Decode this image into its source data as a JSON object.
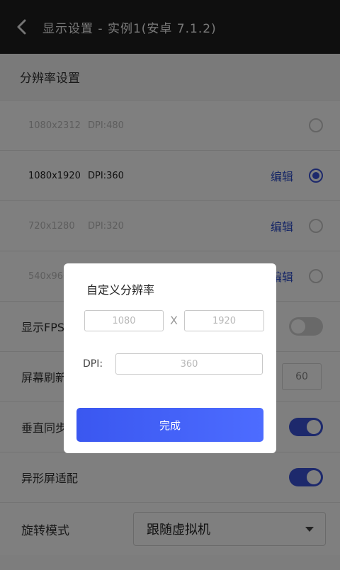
{
  "header": {
    "back_icon": "chevron-left-icon",
    "title": "显示设置 - 实例1(安卓 7.1.2)"
  },
  "resolution_section": {
    "title": "分辨率设置",
    "items": [
      {
        "res": "1080x2312",
        "dpi": "DPI:480",
        "edit": "",
        "selected": false,
        "enabled": false
      },
      {
        "res": "1080x1920",
        "dpi": "DPI:360",
        "edit": "编辑",
        "selected": true,
        "enabled": true
      },
      {
        "res": "720x1280",
        "dpi": "DPI:320",
        "edit": "编辑",
        "selected": false,
        "enabled": false
      },
      {
        "res": "540x960",
        "dpi": "",
        "edit": "编辑",
        "selected": false,
        "enabled": false
      }
    ]
  },
  "settings": {
    "show_fps_label": "显示FPS",
    "show_fps_on": false,
    "refresh_label": "屏幕刷新",
    "refresh_value": "60",
    "vsync_label": "垂直同步",
    "vsync_on": true,
    "notch_label": "异形屏适配",
    "notch_on": true,
    "rotate_label": "旋转模式",
    "rotate_value": "跟随虚拟机"
  },
  "dialog": {
    "title": "自定义分辨率",
    "width_placeholder": "1080",
    "height_placeholder": "1920",
    "times": "X",
    "dpi_label": "DPI:",
    "dpi_placeholder": "360",
    "done_label": "完成"
  },
  "colors": {
    "accent": "#3a53d8",
    "header_bg": "#1f1f1f",
    "edit_text": "#2a4ccc"
  }
}
